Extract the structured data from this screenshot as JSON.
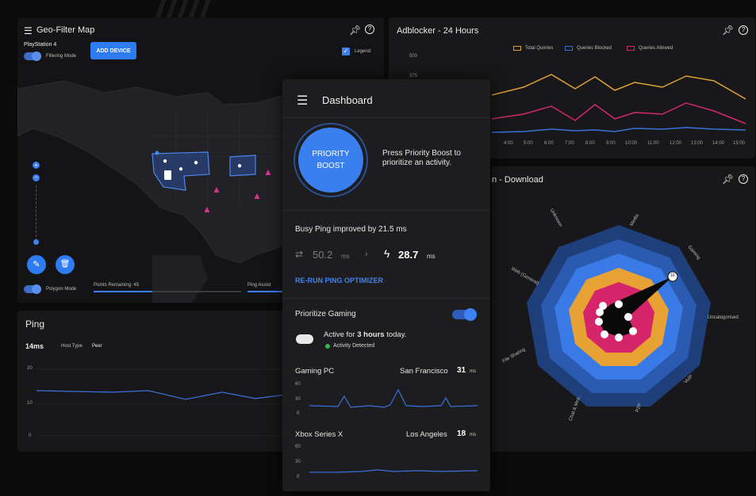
{
  "geo": {
    "title": "Geo-Filter Map",
    "device": "PlayStation 4",
    "filtering_mode": "Filtering Mode",
    "add_device": "ADD DEVICE",
    "legend": "Legend",
    "polygon_mode": "Polygon Mode",
    "points_remaining": "Points Remaining: 45",
    "ping_assist": "Ping Assist"
  },
  "adblocker": {
    "title": "Adblocker - 24 Hours",
    "legend": [
      "Total Queries",
      "Queries Blocked",
      "Queries Allowed"
    ],
    "y_ticks": [
      "500",
      "375"
    ],
    "x_ticks": [
      "4:00",
      "5:00",
      "6:00",
      "7:00",
      "8:00",
      "9:00",
      "10:00",
      "11:00",
      "12:00",
      "13:00",
      "14:00",
      "15:00"
    ],
    "colors": {
      "total": "#e0a032",
      "blocked": "#3a6fd8",
      "allowed": "#d2286e"
    }
  },
  "radar": {
    "title": "n - Download",
    "labels": [
      "Media",
      "Gaming",
      "Uncategorised",
      "VoIP",
      "P2P",
      "Chat & Mes..",
      "File Sharing",
      "Web (General)",
      "Unknown"
    ],
    "marker_values": [
      "1",
      "2",
      "3",
      "4",
      "5",
      "6",
      "7",
      "8",
      "9"
    ],
    "center_value": "10"
  },
  "ping": {
    "title": "Ping",
    "value": "14ms",
    "host_type_label": "Host Type",
    "host_type_value": "Peer",
    "y_ticks": [
      "20",
      "10",
      "0"
    ]
  },
  "dashboard": {
    "title": "Dashboard",
    "boost_label_1": "PRIORITY",
    "boost_label_2": "BOOST",
    "boost_text": "Press Priority Boost to prioritize an activity.",
    "ping_improved": "Busy Ping improved by 21.5 ms",
    "old_ping": "50.2",
    "old_unit": "ms",
    "new_ping": "28.7",
    "new_unit": "ms",
    "rerun": "RE-RUN PING OPTIMIZER",
    "prioritize": "Prioritize Gaming",
    "active_prefix": "Active for ",
    "active_hours": "3 hours",
    "active_suffix": " today.",
    "activity": "Activity Detected",
    "devices": [
      {
        "name": "Gaming PC",
        "location": "San Francisco",
        "ping": "31",
        "unit": "ms",
        "y_ticks": [
          "60",
          "30",
          "0"
        ]
      },
      {
        "name": "Xbox Series X",
        "location": "Los Angeles",
        "ping": "18",
        "unit": "ms",
        "y_ticks": [
          "60",
          "30",
          "0"
        ]
      }
    ]
  }
}
